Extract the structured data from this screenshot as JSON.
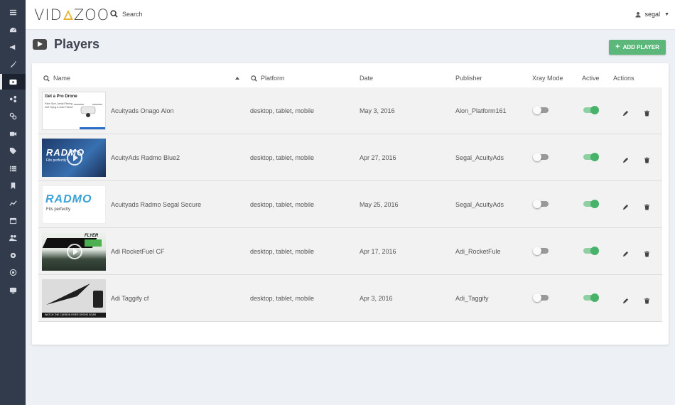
{
  "app": {
    "logo_left": "VID",
    "logo_right": "ZOO",
    "brand_accent": "#e6b32f"
  },
  "header": {
    "search_label": "Search",
    "username": "segal"
  },
  "sidebar": {
    "items": [
      {
        "icon": "hamburger-icon"
      },
      {
        "icon": "dashboard-icon"
      },
      {
        "icon": "megaphone-icon"
      },
      {
        "icon": "wand-icon"
      },
      {
        "icon": "play-icon",
        "active": true
      },
      {
        "icon": "share-icon"
      },
      {
        "icon": "link-icon"
      },
      {
        "icon": "video-camera-icon"
      },
      {
        "icon": "tag-icon"
      },
      {
        "icon": "list-icon"
      },
      {
        "icon": "bookmark-icon"
      },
      {
        "icon": "line-chart-icon"
      },
      {
        "icon": "calendar-icon"
      },
      {
        "icon": "users-icon"
      },
      {
        "icon": "gear-icon"
      },
      {
        "icon": "target-icon"
      },
      {
        "icon": "monitor-icon"
      }
    ]
  },
  "page": {
    "title": "Players",
    "add_button_label": "ADD PLAYER",
    "accent_color": "#5cb87a"
  },
  "table": {
    "columns": {
      "name": "Name",
      "platform": "Platform",
      "date": "Date",
      "publisher": "Publisher",
      "xray": "Xray Mode",
      "active": "Active",
      "actions": "Actions"
    },
    "rows": [
      {
        "name": "Acuityads Onago Alon",
        "platform": "desktop, tablet, mobile",
        "date": "May 3, 2016",
        "publisher": "Alon_Platform161",
        "xray": false,
        "active": true,
        "thumb": {
          "kind": "drone",
          "headline": "Get a Pro Drone",
          "lines": "Palm Size, Aerial Filming, Self Flying & Auto Follow!",
          "footnote": "• High Res Camera • FWP Build"
        }
      },
      {
        "name": "AcuityAds Radmo Blue2",
        "platform": "desktop, tablet, mobile",
        "date": "Apr 27, 2016",
        "publisher": "Segal_AcuityAds",
        "xray": false,
        "active": true,
        "thumb": {
          "kind": "radmo-dark",
          "wordmark": "RADMO",
          "tagline": "Fits perfectly"
        }
      },
      {
        "name": "Acuityads Radmo Segal Secure",
        "platform": "desktop, tablet, mobile",
        "date": "May 25, 2016",
        "publisher": "Segal_AcuityAds",
        "xray": false,
        "active": true,
        "thumb": {
          "kind": "radmo-light",
          "wordmark": "RADMO",
          "tagline": "Fits perfectly"
        }
      },
      {
        "name": "Adi RocketFuel CF",
        "platform": "desktop, tablet, mobile",
        "date": "Apr 17, 2016",
        "publisher": "Adi_RocketFule",
        "xray": false,
        "active": true,
        "thumb": {
          "kind": "flyer",
          "label": "FLYER"
        }
      },
      {
        "name": "Adi Taggify cf",
        "platform": "desktop, tablet, mobile",
        "date": "Apr 3, 2016",
        "publisher": "Adi_Taggify",
        "xray": false,
        "active": true,
        "thumb": {
          "kind": "taggify",
          "strip": "WATCH THE CARBON FIBER DRONE SOAR"
        }
      }
    ]
  }
}
